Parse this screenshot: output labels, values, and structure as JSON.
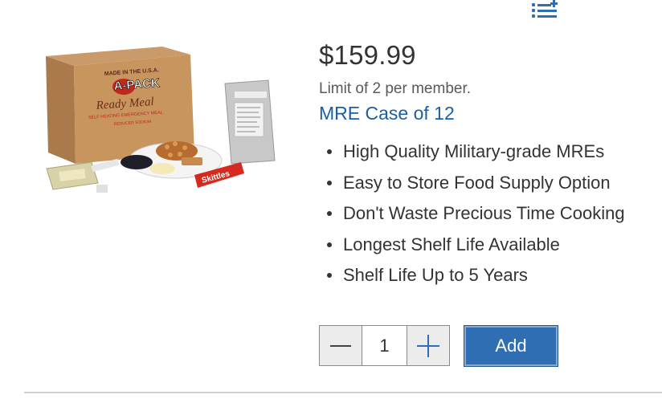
{
  "header": {
    "icon": "list-add-icon"
  },
  "product": {
    "image": {
      "icon": "product-photo",
      "box_text_made_in": "MADE IN THE U.S.A.",
      "box_text_brand": "A-PACK",
      "box_text_ready_meal": "Ready Meal",
      "box_text_self_heating": "SELF-HEATING EMERGENCY MEAL",
      "box_text_reduced_sodium": "REDUCED SODIUM",
      "snack_text": "Skittles"
    },
    "price": "$159.99",
    "limit": "Limit of 2 per member.",
    "title": "MRE Case of 12",
    "features": [
      "High Quality Military-grade MREs",
      "Easy to Store Food Supply Option",
      "Don't Waste Precious Time Cooking",
      "Longest Shelf Life Available",
      "Shelf Life Up to 5 Years"
    ]
  },
  "purchase": {
    "quantity": "1",
    "decrement_icon": "minus-icon",
    "increment_icon": "plus-icon",
    "add_label": "Add"
  },
  "colors": {
    "link": "#1a5ea8",
    "add_button": "#2f6eb3",
    "icon": "#2f6eb3"
  }
}
